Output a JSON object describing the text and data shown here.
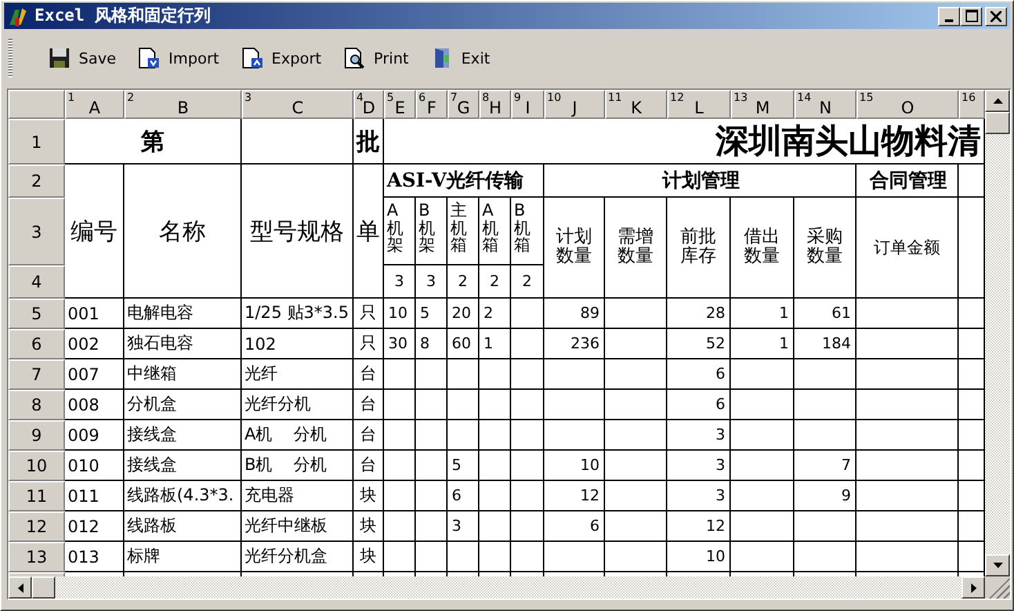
{
  "window": {
    "title": "Excel 风格和固定行列"
  },
  "toolbar": [
    {
      "kind": "save",
      "label": "Save"
    },
    {
      "kind": "import",
      "label": "Import"
    },
    {
      "kind": "export",
      "label": "Export"
    },
    {
      "kind": "print",
      "label": "Print"
    },
    {
      "kind": "exit",
      "label": "Exit"
    }
  ],
  "sheet": {
    "columns": [
      {
        "number": "1",
        "letter": "A"
      },
      {
        "number": "2",
        "letter": "B"
      },
      {
        "number": "3",
        "letter": "C"
      },
      {
        "number": "4",
        "letter": "D"
      },
      {
        "number": "5",
        "letter": "E"
      },
      {
        "number": "6",
        "letter": "F"
      },
      {
        "number": "7",
        "letter": "G"
      },
      {
        "number": "8",
        "letter": "H"
      },
      {
        "number": "9",
        "letter": "I"
      },
      {
        "number": "10",
        "letter": "J"
      },
      {
        "number": "11",
        "letter": "K"
      },
      {
        "number": "12",
        "letter": "L"
      },
      {
        "number": "13",
        "letter": "M"
      },
      {
        "number": "14",
        "letter": "N"
      },
      {
        "number": "15",
        "letter": "O"
      },
      {
        "number": "16"
      }
    ],
    "row_numbers": [
      "1",
      "2",
      "3",
      "4",
      "5",
      "6",
      "7",
      "8",
      "9",
      "10",
      "11",
      "12",
      "13"
    ],
    "banner": {
      "left": "第",
      "unit": "批",
      "title": "深圳南头山物料清"
    },
    "headings": {
      "code": "编号",
      "name": "名称",
      "spec": "型号规格",
      "unit": "单",
      "groups": [
        "ASI-V光纤传输",
        "计划管理",
        "合同管理"
      ],
      "asi_columns": [
        {
          "label": "A机架",
          "count": "3"
        },
        {
          "label": "B机架",
          "count": "3"
        },
        {
          "label": "主机箱",
          "count": "2"
        },
        {
          "label": "A机箱",
          "count": "2"
        },
        {
          "label": "B机箱",
          "count": "2"
        }
      ],
      "plan_columns": [
        "计划数量",
        "需增数量",
        "前批库存",
        "借出数量",
        "采购数量"
      ],
      "contract_columns": [
        "订单金额"
      ]
    },
    "rows": [
      {
        "code": "001",
        "name": "电解电容",
        "spec": "1/25 贴3*3.5",
        "unit": "只",
        "asi": {
          "a_frame": "10",
          "b_frame": "5",
          "main_box": "20",
          "a_box": "2"
        },
        "plan": {
          "planned": "89",
          "in_stock": "28",
          "lent": "1",
          "purchase": "61"
        }
      },
      {
        "code": "002",
        "name": "独石电容",
        "spec": "102",
        "unit": "只",
        "asi": {
          "a_frame": "30",
          "b_frame": "8",
          "main_box": "60",
          "a_box": "1"
        },
        "plan": {
          "planned": "236",
          "in_stock": "52",
          "lent": "1",
          "purchase": "184"
        }
      },
      {
        "code": "007",
        "name": "中继箱",
        "spec": "光纤",
        "unit": "台",
        "plan": {
          "in_stock": "6"
        }
      },
      {
        "code": "008",
        "name": "分机盒",
        "spec": "光纤分机",
        "unit": "台",
        "plan": {
          "in_stock": "6"
        }
      },
      {
        "code": "009",
        "name": "接线盒",
        "spec": "A机    分机",
        "unit": "台",
        "plan": {
          "in_stock": "3"
        }
      },
      {
        "code": "010",
        "name": "接线盒",
        "spec": "B机    分机",
        "unit": "台",
        "asi": {
          "main_box": "5"
        },
        "plan": {
          "planned": "10",
          "in_stock": "3",
          "purchase": "7"
        }
      },
      {
        "code": "011",
        "name": "线路板(4.3*3.",
        "spec": "充电器",
        "unit": "块",
        "asi": {
          "main_box": "6"
        },
        "plan": {
          "planned": "12",
          "in_stock": "3",
          "purchase": "9"
        }
      },
      {
        "code": "012",
        "name": "线路板",
        "spec": "光纤中继板",
        "unit": "块",
        "asi": {
          "main_box": "3"
        },
        "plan": {
          "planned": "6",
          "in_stock": "12"
        }
      },
      {
        "code": "013",
        "name": "标牌",
        "spec": "光纤分机盒",
        "unit": "块",
        "plan": {
          "in_stock": "10"
        }
      }
    ]
  }
}
